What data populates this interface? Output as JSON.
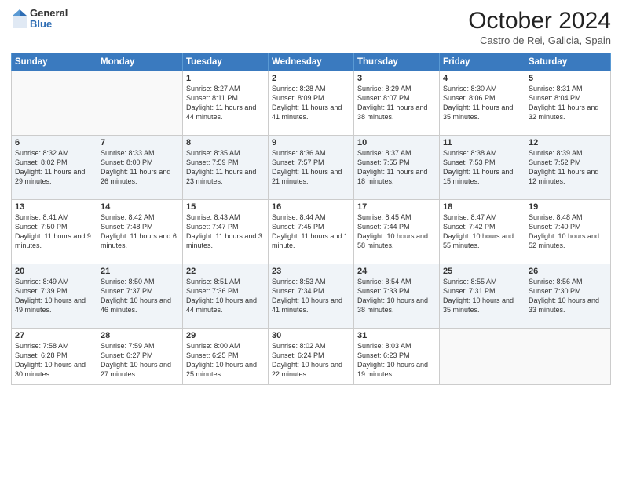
{
  "logo": {
    "general": "General",
    "blue": "Blue"
  },
  "header": {
    "month": "October 2024",
    "location": "Castro de Rei, Galicia, Spain"
  },
  "weekdays": [
    "Sunday",
    "Monday",
    "Tuesday",
    "Wednesday",
    "Thursday",
    "Friday",
    "Saturday"
  ],
  "weeks": [
    [
      {
        "day": "",
        "info": ""
      },
      {
        "day": "",
        "info": ""
      },
      {
        "day": "1",
        "info": "Sunrise: 8:27 AM\nSunset: 8:11 PM\nDaylight: 11 hours and 44 minutes."
      },
      {
        "day": "2",
        "info": "Sunrise: 8:28 AM\nSunset: 8:09 PM\nDaylight: 11 hours and 41 minutes."
      },
      {
        "day": "3",
        "info": "Sunrise: 8:29 AM\nSunset: 8:07 PM\nDaylight: 11 hours and 38 minutes."
      },
      {
        "day": "4",
        "info": "Sunrise: 8:30 AM\nSunset: 8:06 PM\nDaylight: 11 hours and 35 minutes."
      },
      {
        "day": "5",
        "info": "Sunrise: 8:31 AM\nSunset: 8:04 PM\nDaylight: 11 hours and 32 minutes."
      }
    ],
    [
      {
        "day": "6",
        "info": "Sunrise: 8:32 AM\nSunset: 8:02 PM\nDaylight: 11 hours and 29 minutes."
      },
      {
        "day": "7",
        "info": "Sunrise: 8:33 AM\nSunset: 8:00 PM\nDaylight: 11 hours and 26 minutes."
      },
      {
        "day": "8",
        "info": "Sunrise: 8:35 AM\nSunset: 7:59 PM\nDaylight: 11 hours and 23 minutes."
      },
      {
        "day": "9",
        "info": "Sunrise: 8:36 AM\nSunset: 7:57 PM\nDaylight: 11 hours and 21 minutes."
      },
      {
        "day": "10",
        "info": "Sunrise: 8:37 AM\nSunset: 7:55 PM\nDaylight: 11 hours and 18 minutes."
      },
      {
        "day": "11",
        "info": "Sunrise: 8:38 AM\nSunset: 7:53 PM\nDaylight: 11 hours and 15 minutes."
      },
      {
        "day": "12",
        "info": "Sunrise: 8:39 AM\nSunset: 7:52 PM\nDaylight: 11 hours and 12 minutes."
      }
    ],
    [
      {
        "day": "13",
        "info": "Sunrise: 8:41 AM\nSunset: 7:50 PM\nDaylight: 11 hours and 9 minutes."
      },
      {
        "day": "14",
        "info": "Sunrise: 8:42 AM\nSunset: 7:48 PM\nDaylight: 11 hours and 6 minutes."
      },
      {
        "day": "15",
        "info": "Sunrise: 8:43 AM\nSunset: 7:47 PM\nDaylight: 11 hours and 3 minutes."
      },
      {
        "day": "16",
        "info": "Sunrise: 8:44 AM\nSunset: 7:45 PM\nDaylight: 11 hours and 1 minute."
      },
      {
        "day": "17",
        "info": "Sunrise: 8:45 AM\nSunset: 7:44 PM\nDaylight: 10 hours and 58 minutes."
      },
      {
        "day": "18",
        "info": "Sunrise: 8:47 AM\nSunset: 7:42 PM\nDaylight: 10 hours and 55 minutes."
      },
      {
        "day": "19",
        "info": "Sunrise: 8:48 AM\nSunset: 7:40 PM\nDaylight: 10 hours and 52 minutes."
      }
    ],
    [
      {
        "day": "20",
        "info": "Sunrise: 8:49 AM\nSunset: 7:39 PM\nDaylight: 10 hours and 49 minutes."
      },
      {
        "day": "21",
        "info": "Sunrise: 8:50 AM\nSunset: 7:37 PM\nDaylight: 10 hours and 46 minutes."
      },
      {
        "day": "22",
        "info": "Sunrise: 8:51 AM\nSunset: 7:36 PM\nDaylight: 10 hours and 44 minutes."
      },
      {
        "day": "23",
        "info": "Sunrise: 8:53 AM\nSunset: 7:34 PM\nDaylight: 10 hours and 41 minutes."
      },
      {
        "day": "24",
        "info": "Sunrise: 8:54 AM\nSunset: 7:33 PM\nDaylight: 10 hours and 38 minutes."
      },
      {
        "day": "25",
        "info": "Sunrise: 8:55 AM\nSunset: 7:31 PM\nDaylight: 10 hours and 35 minutes."
      },
      {
        "day": "26",
        "info": "Sunrise: 8:56 AM\nSunset: 7:30 PM\nDaylight: 10 hours and 33 minutes."
      }
    ],
    [
      {
        "day": "27",
        "info": "Sunrise: 7:58 AM\nSunset: 6:28 PM\nDaylight: 10 hours and 30 minutes."
      },
      {
        "day": "28",
        "info": "Sunrise: 7:59 AM\nSunset: 6:27 PM\nDaylight: 10 hours and 27 minutes."
      },
      {
        "day": "29",
        "info": "Sunrise: 8:00 AM\nSunset: 6:25 PM\nDaylight: 10 hours and 25 minutes."
      },
      {
        "day": "30",
        "info": "Sunrise: 8:02 AM\nSunset: 6:24 PM\nDaylight: 10 hours and 22 minutes."
      },
      {
        "day": "31",
        "info": "Sunrise: 8:03 AM\nSunset: 6:23 PM\nDaylight: 10 hours and 19 minutes."
      },
      {
        "day": "",
        "info": ""
      },
      {
        "day": "",
        "info": ""
      }
    ]
  ]
}
